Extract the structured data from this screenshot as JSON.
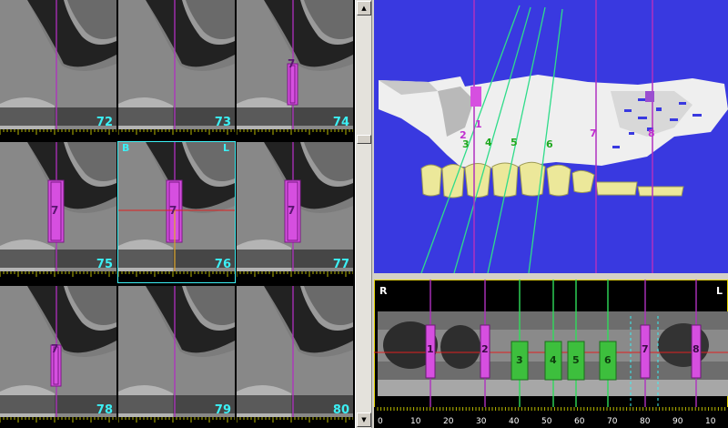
{
  "slices": [
    {
      "num": "72",
      "implant": null
    },
    {
      "num": "73",
      "implant": null
    },
    {
      "num": "74",
      "implant": "7"
    },
    {
      "num": "75",
      "implant": "7"
    },
    {
      "num": "76",
      "implant": "7",
      "active": true
    },
    {
      "num": "77",
      "implant": "7"
    },
    {
      "num": "78",
      "implant": "7"
    },
    {
      "num": "79",
      "implant": null
    },
    {
      "num": "80",
      "implant": null
    }
  ],
  "active_slice": {
    "left_corner": "B",
    "right_corner": "L"
  },
  "view3d": {
    "implant_labels": [
      "1",
      "2",
      "3",
      "4",
      "5",
      "6",
      "7",
      "8"
    ]
  },
  "panoramic": {
    "left_corner": "R",
    "right_corner": "L",
    "implants": [
      "1",
      "2",
      "3",
      "4",
      "5",
      "6",
      "7",
      "8"
    ],
    "ruler_labels": [
      "0",
      "10",
      "20",
      "30",
      "40",
      "50",
      "60",
      "70",
      "80",
      "90",
      "10"
    ]
  },
  "colors": {
    "accent_cyan": "#3cf0f5",
    "implant_magenta": "#d64fe0",
    "implant_green": "#3dbf3d",
    "viewport_blue": "#3939e0",
    "crosshair_red": "#e02020"
  },
  "icons": {
    "scroll_up": "triangle-up",
    "scroll_down": "triangle-down"
  }
}
